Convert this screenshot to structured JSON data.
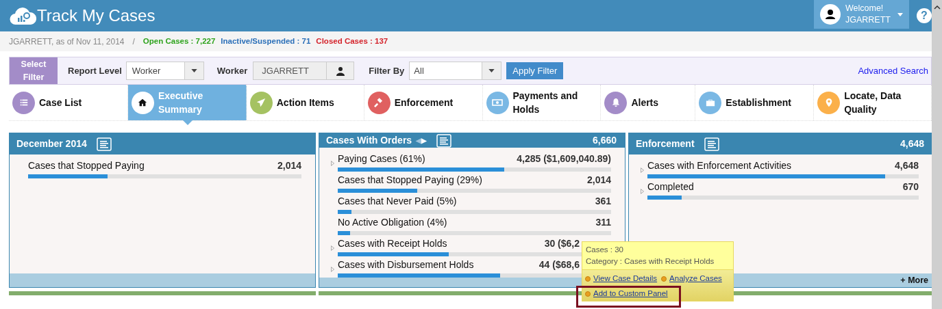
{
  "app": {
    "title": "Track My Cases",
    "welcome": "Welcome!",
    "user": "JGARRETT",
    "help": "?"
  },
  "summary": {
    "as_of": "JGARRETT, as of Nov 11, 2014",
    "separator": "/",
    "stats": [
      {
        "label": "Open Cases : 7,227",
        "color": "#2ea31c"
      },
      {
        "label": "Inactive/Suspended : 71",
        "color": "#2a6fb8"
      },
      {
        "label": "Closed Cases : 137",
        "color": "#d4232b"
      }
    ]
  },
  "filter": {
    "title": "Select Filter",
    "report_level_label": "Report Level",
    "report_level": "Worker",
    "worker_label": "Worker",
    "worker": "JGARRETT",
    "filter_by_label": "Filter By",
    "filter_by": "All",
    "apply": "Apply Filter",
    "advanced": "Advanced Search"
  },
  "tabs": [
    {
      "label": "Case List",
      "color": "#a38cc8",
      "selected": false
    },
    {
      "label": "Executive Summary",
      "color": "#ffffff",
      "selected": true
    },
    {
      "label": "Action Items",
      "color": "#a5c262",
      "selected": false
    },
    {
      "label": "Enforcement",
      "color": "#e06060",
      "selected": false
    },
    {
      "label": "Payments and Holds",
      "color": "#7ab8e4",
      "selected": false
    },
    {
      "label": "Alerts",
      "color": "#a38cc8",
      "selected": false
    },
    {
      "label": "Establishment",
      "color": "#7ab8e4",
      "selected": false
    },
    {
      "label": "Locate, Data Quality",
      "color": "#fbb04a",
      "selected": false
    }
  ],
  "panels": [
    {
      "title": "December 2014",
      "rows": [
        {
          "label": "Cases that Stopped Paying",
          "value": "2,014",
          "expandable": false,
          "level": 0.29,
          "kind": "plain"
        }
      ]
    },
    {
      "title": "Cases With Orders",
      "nav_arrows": [
        "◀",
        "▶"
      ],
      "total": "6,660",
      "rows": [
        {
          "label": "Paying Cases (61%)",
          "value": "4,285 ($1,609,040.89)",
          "expandable": true,
          "level": 0.61,
          "kind": "plain"
        },
        {
          "label": "Cases that Stopped Paying (29%)",
          "value": "2,014",
          "expandable": false,
          "level": 0.29,
          "kind": "plain"
        },
        {
          "label": "Cases that Never Paid (5%)",
          "value": "361",
          "expandable": false,
          "level": 0.05,
          "kind": "plain"
        },
        {
          "label": "No Active Obligation (4%)",
          "value": "311",
          "expandable": false,
          "level": 0.045,
          "kind": "plain"
        },
        {
          "label": "Cases with Receipt Holds",
          "value": "30 ($6,2",
          "expandable": true,
          "level": 0.405,
          "kind": "covered"
        },
        {
          "label": "Cases with Disbursement Holds",
          "value": "44 ($68,6",
          "expandable": true,
          "level": 0.595,
          "kind": "covered"
        }
      ]
    },
    {
      "title": "Enforcement",
      "total": "4,648",
      "more": "+ More",
      "rows": [
        {
          "label": "Cases with Enforcement Activities",
          "value": "4,648",
          "expandable": true,
          "level": 0.875,
          "kind": "plain"
        },
        {
          "label": "Completed",
          "value": "670",
          "expandable": true,
          "level": 0.126,
          "kind": "plain"
        }
      ]
    }
  ],
  "tooltip": {
    "lines": [
      "Cases : 30",
      "Category : Cases with Receipt Holds"
    ],
    "links": [
      "View Case Details",
      "Analyze Cases",
      "Add to Custom Panel"
    ]
  }
}
